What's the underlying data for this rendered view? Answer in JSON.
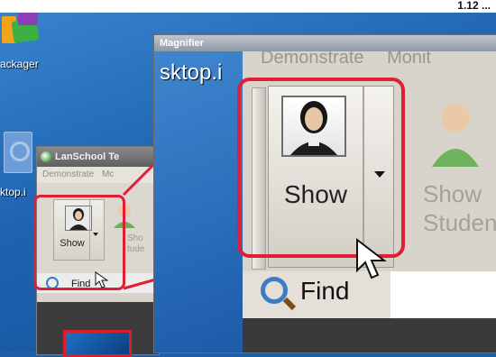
{
  "top_strip": {
    "text": "1.12 ..."
  },
  "desktop": {
    "icons": [
      {
        "label": "ackager",
        "icon": "packager-icon"
      },
      {
        "label": "ktop.i",
        "icon": "file-icon"
      }
    ]
  },
  "lanschool_window": {
    "title": "LanSchool Te",
    "menu": [
      "Demonstrate",
      "Mc"
    ],
    "show_button_label": "Show",
    "student_button_label": "Sho\ntude",
    "find_label": "Find"
  },
  "magnifier": {
    "title": "Magnifier",
    "left_text": "sktop.i",
    "menu": [
      "Demonstrate",
      "Monit"
    ],
    "show_button_label": "Show",
    "student_button_label": "Show\nStudent",
    "find_label": "Find"
  },
  "colors": {
    "highlight": "#e01e35",
    "desktop": "#1e5fa8"
  }
}
